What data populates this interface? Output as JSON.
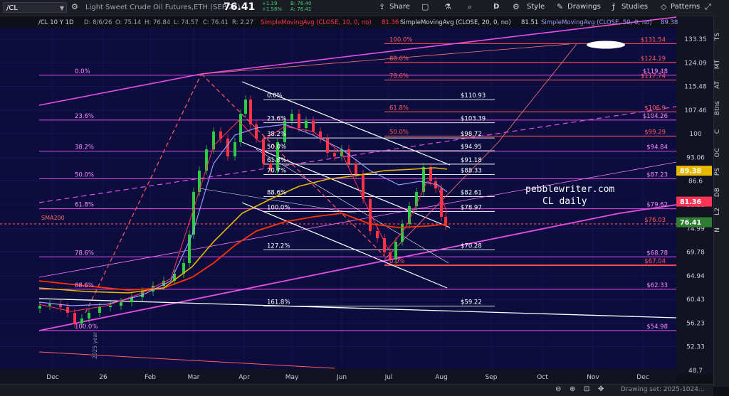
{
  "toolbar": {
    "symbol": "/CL",
    "description": "Light Sweet Crude Oil Futures,ETH (SEP 26)",
    "last_price": "76.41",
    "change": "+1.19",
    "change_pct": "+1.58%",
    "bid": "B: 76.40",
    "ask": "A: 76.41",
    "share": "Share",
    "letter_d": "D",
    "style": "Style",
    "drawings": "Drawings",
    "studies": "Studies",
    "patterns": "Patterns"
  },
  "header": {
    "text": "/CL 10 Y 1D",
    "date": "D: 8/6/26",
    "open": "O: 75.14",
    "high": "H: 76.84",
    "low": "L: 74.57",
    "close": "C: 76.41",
    "range": "R: 2.27",
    "sma10_label": "SimpleMovingAvg (CLOSE, 10, 0, no)",
    "sma10_value": "81.36",
    "sma20_label": "SimpleMovingAvg (CLOSE, 20, 0, no)",
    "sma20_value": "81.51",
    "sma50_label": "SimpleMovingAvg (CLOSE, 50, 0, no)",
    "sma50_value": "89.38"
  },
  "right_toolbar": [
    "TS",
    "MT",
    "AT",
    "Btns",
    "C",
    "OC",
    "PS",
    "DB",
    "L2",
    "N"
  ],
  "status": {
    "drawing_set": "Drawing set: 2025-1024..."
  },
  "colors": {
    "background": "#0c0c3e",
    "magenta": "#e64fe6",
    "red": "#ff4d4d",
    "white": "#ffffff",
    "sma10": "#ff3355",
    "sma20": "#9999ff",
    "sma50": "#e6b800",
    "sma200": "#ff3300",
    "up_candle": "#2ecc40",
    "down_candle": "#ff3344"
  },
  "chart_data": {
    "type": "line",
    "annotation": "pebblewriter.com\nCL daily",
    "yaxis_ticks": [
      "133.35",
      "124.09",
      "115.48",
      "107.46",
      "100",
      "93.06",
      "86.6",
      "80.58",
      "74.99",
      "69.78",
      "64.94",
      "60.43",
      "56.23",
      "52.33",
      "48.7"
    ],
    "xaxis_ticks": [
      "Dec",
      "26",
      "Feb",
      "Mar",
      "Apr",
      "May",
      "Jun",
      "Jul",
      "Aug",
      "Sep",
      "Oct",
      "Nov",
      "Dec"
    ],
    "price_badges": [
      {
        "label": "89.38",
        "value": 89.38,
        "color": "#e6b800"
      },
      {
        "label": "81.36",
        "value": 81.36,
        "color": "#ff3355"
      },
      {
        "label": "76.41",
        "value": 76.41,
        "color": "#2e7d32"
      }
    ],
    "sma200_label": "SMA200",
    "year_label": "2025 year",
    "fib_large": [
      {
        "label": "0.0%",
        "value": 119.48
      },
      {
        "label": "23.6%",
        "value": 104.26
      },
      {
        "label": "38.2%",
        "value": 94.84
      },
      {
        "label": "50.0%",
        "value": 87.23
      },
      {
        "label": "61.8%",
        "value": 79.62
      },
      {
        "label": "78.6%",
        "value": 68.78
      },
      {
        "label": "88.6%",
        "value": 62.33
      },
      {
        "label": "100.0%",
        "value": 54.98
      }
    ],
    "fib_right_prices": [
      {
        "label": "$119.48",
        "value": 119.48
      },
      {
        "label": "$104.26",
        "value": 104.26
      },
      {
        "label": "$94.84",
        "value": 94.84
      },
      {
        "label": "$87.23",
        "value": 87.23
      },
      {
        "label": "$79.62",
        "value": 79.62
      },
      {
        "label": "$68.78",
        "value": 68.78
      },
      {
        "label": "$62.33",
        "value": 62.33
      },
      {
        "label": "$54.98",
        "value": 54.98
      }
    ],
    "fib_red": [
      {
        "label": "100.0%",
        "value": 131.54,
        "price": "$131.54"
      },
      {
        "label": "88.6%",
        "value": 124.19,
        "price": "$124.19"
      },
      {
        "label": "78.6%",
        "value": 117.74,
        "price": "$117.74"
      },
      {
        "label": "61.8%",
        "value": 106.9,
        "price": "$106.9"
      },
      {
        "label": "50.0%",
        "value": 99.29,
        "price": "$99.29"
      },
      {
        "label": "",
        "value": 76.03,
        "price": "$76.03"
      },
      {
        "label": "0.0%",
        "value": 67.04,
        "price": "$67.04"
      }
    ],
    "fib_white": [
      {
        "label": "0.0%",
        "value": 110.93,
        "price": "$110.93"
      },
      {
        "label": "23.6%",
        "value": 103.39,
        "price": "$103.39"
      },
      {
        "label": "38.2%",
        "value": 98.72,
        "price": "$98.72"
      },
      {
        "label": "50.0%",
        "value": 94.95,
        "price": "$94.95"
      },
      {
        "label": "61.8%",
        "value": 91.18,
        "price": "$91.18"
      },
      {
        "label": "70.7%",
        "value": 88.33,
        "price": "$88.33"
      },
      {
        "label": "88.6%",
        "value": 82.61,
        "price": "$82.61"
      },
      {
        "label": "100.0%",
        "value": 78.97,
        "price": "$78.97"
      },
      {
        "label": "127.2%",
        "value": 70.28,
        "price": "$70.28"
      },
      {
        "label": "161.8%",
        "value": 59.22,
        "price": "$59.22"
      }
    ]
  }
}
